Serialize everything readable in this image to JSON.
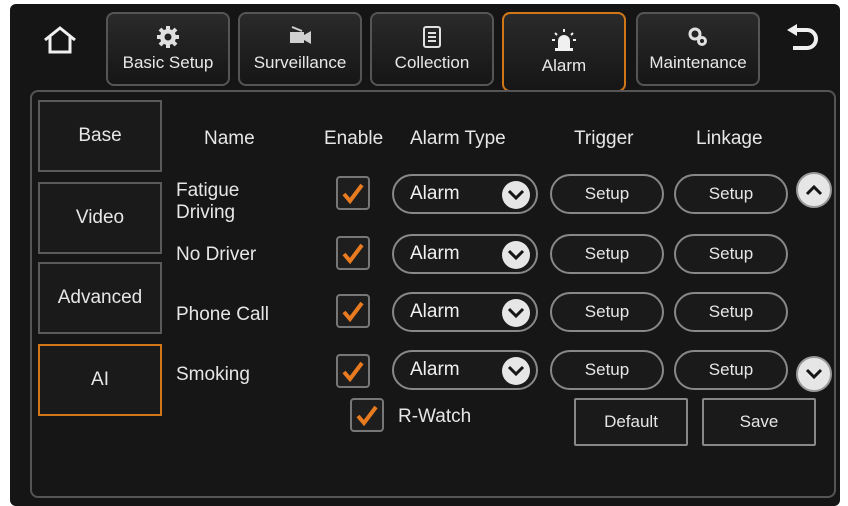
{
  "colors": {
    "accent": "#d07818",
    "background": "#151515",
    "check": "#e87a20"
  },
  "topbar": {
    "home_icon": "home-icon",
    "back_icon": "back-arrow-icon",
    "tabs": [
      {
        "label": "Basic Setup",
        "icon": "gear-icon"
      },
      {
        "label": "Surveillance",
        "icon": "camera-icon"
      },
      {
        "label": "Collection",
        "icon": "document-icon"
      },
      {
        "label": "Alarm",
        "icon": "alarm-light-icon",
        "active": true
      },
      {
        "label": "Maintenance",
        "icon": "gears-icon"
      }
    ]
  },
  "sidebar": {
    "items": [
      {
        "label": "Base"
      },
      {
        "label": "Video"
      },
      {
        "label": "Advanced"
      },
      {
        "label": "AI",
        "active": true
      }
    ]
  },
  "table": {
    "headers": {
      "name": "Name",
      "enable": "Enable",
      "alarm_type": "Alarm Type",
      "trigger": "Trigger",
      "linkage": "Linkage"
    },
    "rows": [
      {
        "name_line1": "Fatigue",
        "name_line2": "Driving",
        "enabled": true,
        "alarm_type": "Alarm",
        "trigger": "Setup",
        "linkage": "Setup"
      },
      {
        "name_line1": "No Driver",
        "enabled": true,
        "alarm_type": "Alarm",
        "trigger": "Setup",
        "linkage": "Setup"
      },
      {
        "name_line1": "Phone Call",
        "enabled": true,
        "alarm_type": "Alarm",
        "trigger": "Setup",
        "linkage": "Setup"
      },
      {
        "name_line1": "Smoking",
        "enabled": true,
        "alarm_type": "Alarm",
        "trigger": "Setup",
        "linkage": "Setup"
      }
    ]
  },
  "rwatch": {
    "label": "R-Watch",
    "checked": true
  },
  "actions": {
    "default_label": "Default",
    "save_label": "Save"
  }
}
